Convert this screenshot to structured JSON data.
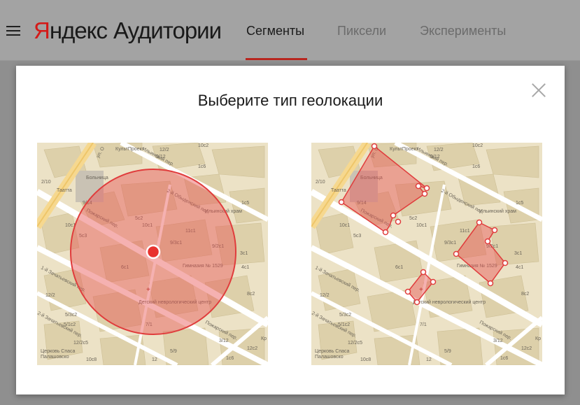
{
  "header": {
    "brand": "Яндекс",
    "brand_first_letter": "Я",
    "brand_rest": "ндекс",
    "product": "Аудитории",
    "tabs": [
      {
        "label": "Сегменты",
        "active": true
      },
      {
        "label": "Пиксели",
        "active": false
      },
      {
        "label": "Эксперименты",
        "active": false
      }
    ],
    "accent_color": "#b8261f",
    "brand_color": "#d41a18"
  },
  "modal": {
    "title": "Выберите тип геолокации",
    "close_icon": "close-icon",
    "options": [
      {
        "type": "radius",
        "label": "map-radius"
      },
      {
        "type": "polygon",
        "label": "map-polygon"
      }
    ]
  },
  "map_labels": {
    "street_1": "Пожарский пер.",
    "street_2": "2-й Обыденский пер.",
    "street_3": "1-й Зачатьевский пер.",
    "street_4": "Пожарский пер.",
    "street_5": "2-й Зачатьевский пер.",
    "street_6": "Ильинский пер.",
    "street_7": "ул. О",
    "poi_1": "КультПроект",
    "poi_2": "Гимназия № 1529",
    "poi_3": "Детский неврологический центр",
    "poi_4": "Ильинский храм",
    "poi_5": "Больница",
    "poi_6": "Таатта",
    "poi_7": "Церковь Спаса",
    "poi_8": "Палашовско",
    "poi_9": "Кр",
    "num_1": "2/10",
    "num_2": "9/14",
    "num_3": "12/2",
    "num_4": "1с5",
    "num_5": "5с2",
    "num_6": "5с3",
    "num_7": "10с1",
    "num_8": "11с1",
    "num_9": "6с1",
    "num_10": "9/2с1",
    "num_11": "3с1",
    "num_12": "4с1",
    "num_13": "8с2",
    "num_14": "12/2",
    "num_15": "10с2",
    "num_16": "5/1с2",
    "num_17": "7/1",
    "num_18": "3/12",
    "num_19": "5/3с2",
    "num_20": "1с6",
    "num_21": "12/2с5",
    "num_22": "12с2",
    "num_23": "9/12",
    "num_24": "12",
    "num_25": "10с1",
    "num_26": "9/3с1",
    "num_27": "10с8",
    "num_28": "1с6",
    "num_29": "5/9"
  }
}
